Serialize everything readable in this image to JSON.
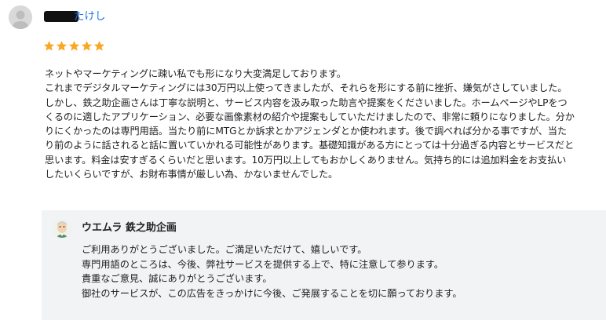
{
  "review": {
    "reviewer_name": "たけし",
    "rating": 5,
    "star_color": "#f9a825",
    "lines": [
      "ネットやマーケティングに疎い私でも形になり大変満足しております。",
      "これまでデジタルマーケティングには30万円以上使ってきましたが、それらを形にする前に挫折、嫌気がさしていました。",
      "しかし、鉄之助企画さんは丁寧な説明と、サービス内容を汲み取った助言や提案をくださいました。ホームページやLPをつ",
      "くるのに適したアプリケーション、必要な画像素材の紹介や提案もしていただけましたので、非常に頼りになりました。分か",
      "りにくかったのは専門用語。当たり前にMTGとか訴求とかアジェンダとか使われます。後で調べれば分かる事ですが、当た",
      "り前のように話されると話に置いていかれる可能性があります。基礎知識がある方にとっては十分過ぎる内容とサービスだと",
      "思います。料金は安すぎるくらいだと思います。10万円以上してもおかしくありません。気持ち的には追加料金をお支払い",
      "したいくらいですが、お財布事情が厳しい為、かないませんでした。"
    ]
  },
  "reply": {
    "owner_name": "ウエムラ 鉄之助企画",
    "lines": [
      "ご利用ありがとうございました。ご満足いただけて、嬉しいです。",
      "専門用語のところは、今後、弊社サービスを提供する上で、特に注意して参ります。",
      "貴重なご意見、誠にありがとうございます。",
      "御社のサービスが、この広告をきっかけに今後、ご発展することを切に願っております。"
    ]
  }
}
